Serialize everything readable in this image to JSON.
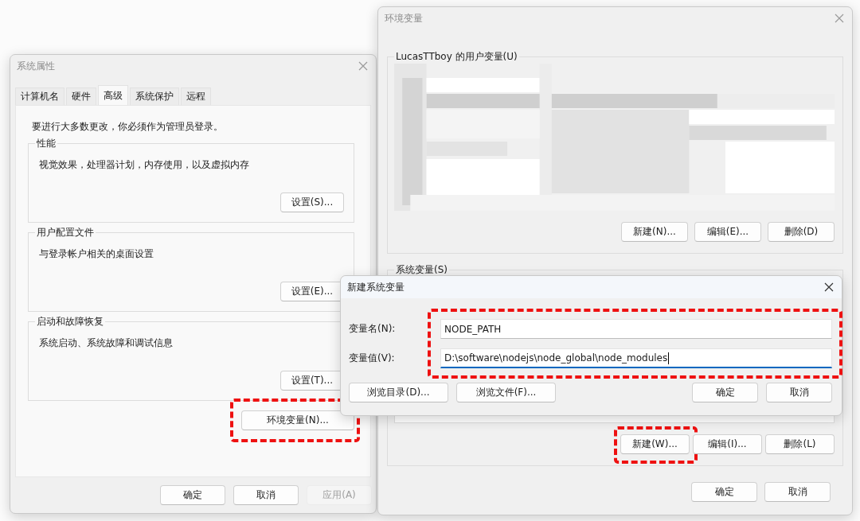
{
  "system_properties": {
    "title": "系统属性",
    "tabs": [
      {
        "label": "计算机名",
        "selected": false
      },
      {
        "label": "硬件",
        "selected": false
      },
      {
        "label": "高级",
        "selected": true
      },
      {
        "label": "系统保护",
        "selected": false
      },
      {
        "label": "远程",
        "selected": false
      }
    ],
    "notice": "要进行大多数更改，你必须作为管理员登录。",
    "groups": [
      {
        "label": "性能",
        "description": "视觉效果，处理器计划，内存使用，以及虚拟内存",
        "button": "设置(S)..."
      },
      {
        "label": "用户配置文件",
        "description": "与登录帐户相关的桌面设置",
        "button": "设置(E)..."
      },
      {
        "label": "启动和故障恢复",
        "description": "系统启动、系统故障和调试信息",
        "button": "设置(T)..."
      }
    ],
    "env_button": {
      "label": "环境变量(N)...",
      "highlighted": true
    },
    "footer_buttons": [
      {
        "label": "确定",
        "disabled": false
      },
      {
        "label": "取消",
        "disabled": false
      },
      {
        "label": "应用(A)",
        "disabled": true
      }
    ]
  },
  "environment_variables": {
    "title": "环境变量",
    "user_group": {
      "label": "LucasTTboy 的用户变量(U)",
      "buttons": [
        {
          "label": "新建(N)...",
          "highlighted": false
        },
        {
          "label": "编辑(E)...",
          "highlighted": false
        },
        {
          "label": "删除(D)",
          "highlighted": false
        }
      ]
    },
    "system_group": {
      "label": "系统变量(S)",
      "buttons": [
        {
          "label": "新建(W)...",
          "highlighted": true
        },
        {
          "label": "编辑(I)...",
          "highlighted": false
        },
        {
          "label": "删除(L)",
          "highlighted": false
        }
      ]
    },
    "footer_buttons": [
      {
        "label": "确定"
      },
      {
        "label": "取消"
      }
    ]
  },
  "new_variable_dialog": {
    "title": "新建系统变量",
    "fields_highlighted": true,
    "fields": [
      {
        "label": "变量名(N):",
        "value": "NODE_PATH",
        "focused": false
      },
      {
        "label": "变量值(V):",
        "value": "D:\\software\\nodejs\\node_global\\node_modules",
        "focused": true
      }
    ],
    "left_buttons": [
      {
        "label": "浏览目录(D)..."
      },
      {
        "label": "浏览文件(F)..."
      }
    ],
    "right_buttons": [
      {
        "label": "确定"
      },
      {
        "label": "取消"
      }
    ]
  }
}
